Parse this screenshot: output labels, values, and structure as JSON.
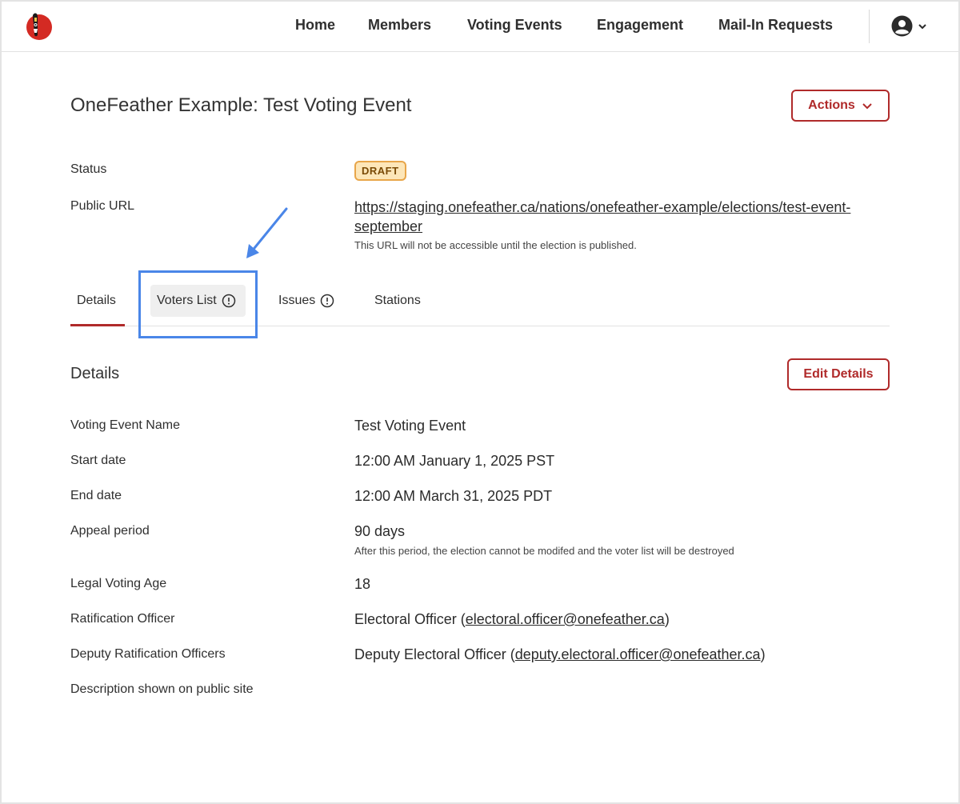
{
  "nav": {
    "items": [
      "Home",
      "Members",
      "Voting Events",
      "Engagement",
      "Mail-In Requests"
    ]
  },
  "header": {
    "title": "OneFeather Example: Test Voting Event",
    "actions_label": "Actions"
  },
  "status": {
    "label": "Status",
    "badge": "DRAFT"
  },
  "public_url": {
    "label": "Public URL",
    "url": "https://staging.onefeather.ca/nations/onefeather-example/elections/test-event-september",
    "note": "This URL will not be accessible until the election is published."
  },
  "tabs": [
    {
      "label": "Details"
    },
    {
      "label": "Voters List"
    },
    {
      "label": "Issues"
    },
    {
      "label": "Stations"
    }
  ],
  "details": {
    "title": "Details",
    "edit_label": "Edit Details",
    "rows": [
      {
        "label": "Voting Event Name",
        "value": "Test Voting Event"
      },
      {
        "label": "Start date",
        "value": "12:00 AM January 1, 2025 PST"
      },
      {
        "label": "End date",
        "value": "12:00 AM March 31, 2025 PDT"
      },
      {
        "label": "Appeal period",
        "value": "90 days",
        "note": "After this period, the election cannot be modifed and the voter list will be destroyed"
      },
      {
        "label": "Legal Voting Age",
        "value": "18"
      },
      {
        "label": "Ratification Officer",
        "name": "Electoral Officer",
        "email": "electoral.officer@onefeather.ca"
      },
      {
        "label": "Deputy Ratification Officers",
        "name": "Deputy Electoral Officer",
        "email": "deputy.electoral.officer@onefeather.ca"
      },
      {
        "label": "Description shown on public site",
        "value": ""
      }
    ]
  },
  "colors": {
    "accent": "#b02a2a",
    "highlight": "#4a86e8",
    "draft_bg": "#fde6b8"
  }
}
